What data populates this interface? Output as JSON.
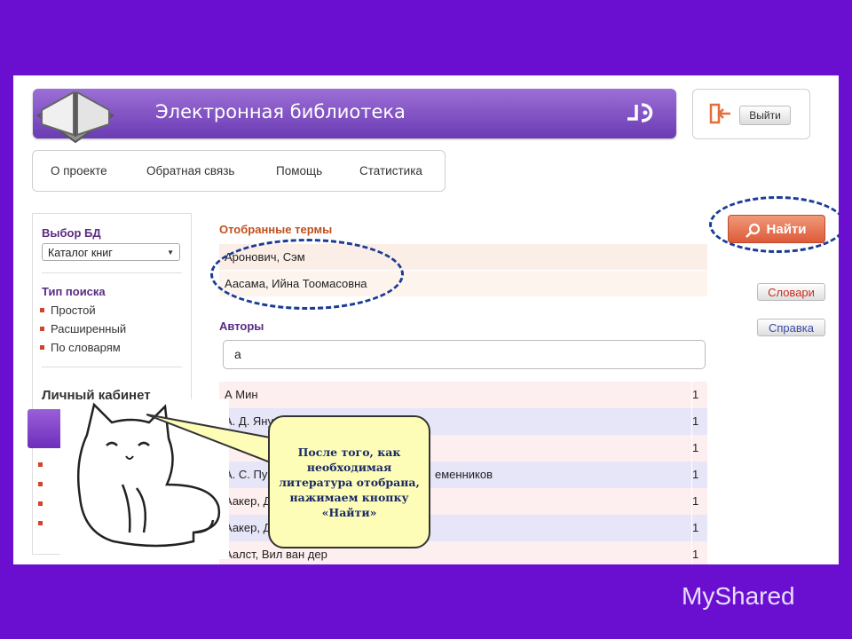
{
  "header": {
    "title": "Электронная библиотека",
    "exit_label": "Выйти"
  },
  "nav": {
    "items": [
      "О проекте",
      "Обратная связь",
      "Помощь",
      "Статистика"
    ]
  },
  "sidebar": {
    "db_heading": "Выбор БД",
    "db_select": "Каталог книг",
    "search_type_heading": "Тип поиска",
    "search_types": [
      "Простой",
      "Расширенный",
      "По словарям"
    ],
    "cabinet_heading": "Личный кабинет"
  },
  "main": {
    "selected_terms_title": "Отобранные термы",
    "selected_terms": [
      "Аронович, Сэм",
      "Аасама, Ийна Тоомасовна"
    ],
    "authors_title": "Авторы",
    "author_input_value": "а",
    "authors": [
      {
        "name": "А Мин",
        "count": "1"
      },
      {
        "name": "А. Д. Януш",
        "count": "1"
      },
      {
        "name": "",
        "count": "1"
      },
      {
        "name": "А. С. Пу",
        "suffix": "еменников",
        "count": "1"
      },
      {
        "name": "Аакер, Д",
        "count": "1"
      },
      {
        "name": "Аакер, Д",
        "count": "1"
      },
      {
        "name": "Аалст, Вил ван дер",
        "count": "1"
      }
    ]
  },
  "actions": {
    "find_label": "Найти",
    "dictionaries_label": "Словари",
    "help_label": "Справка"
  },
  "overlay": {
    "bubble_text": "После того, как необходимая литература отобрана, нажимаем кнопку «Найти»"
  },
  "watermark": "MyShared",
  "colors": {
    "background": "#6a0fd0",
    "banner": "#7e4cc2",
    "accent_orange": "#dd5a3a",
    "heading_orange": "#c0501e",
    "ring": "#1a3c96"
  }
}
